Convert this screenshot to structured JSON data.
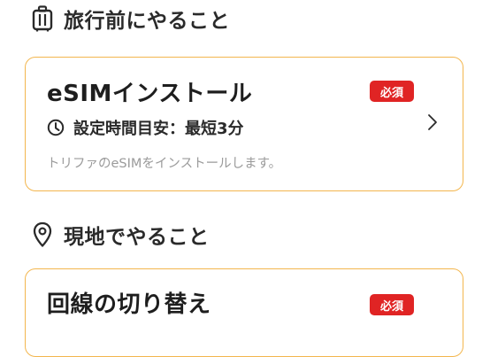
{
  "sections": {
    "before_travel": {
      "icon": "suitcase-icon",
      "title": "旅行前にやること"
    },
    "local": {
      "icon": "location-pin-icon",
      "title": "現地でやること"
    }
  },
  "cards": {
    "esim_install": {
      "title": "eSIMインストール",
      "badge": "必須",
      "time_icon": "clock-icon",
      "time_text": "設定時間目安：最短3分",
      "description": "トリファのeSIMをインストールします。",
      "chevron": "chevron-right-icon"
    },
    "line_switch": {
      "title": "回線の切り替え",
      "badge": "必須"
    }
  },
  "colors": {
    "card_border": "#f3b64e",
    "badge_bg": "#e02424",
    "badge_text": "#ffffff",
    "description_text": "#9b9b9b",
    "title_text": "#1e1e1e"
  }
}
